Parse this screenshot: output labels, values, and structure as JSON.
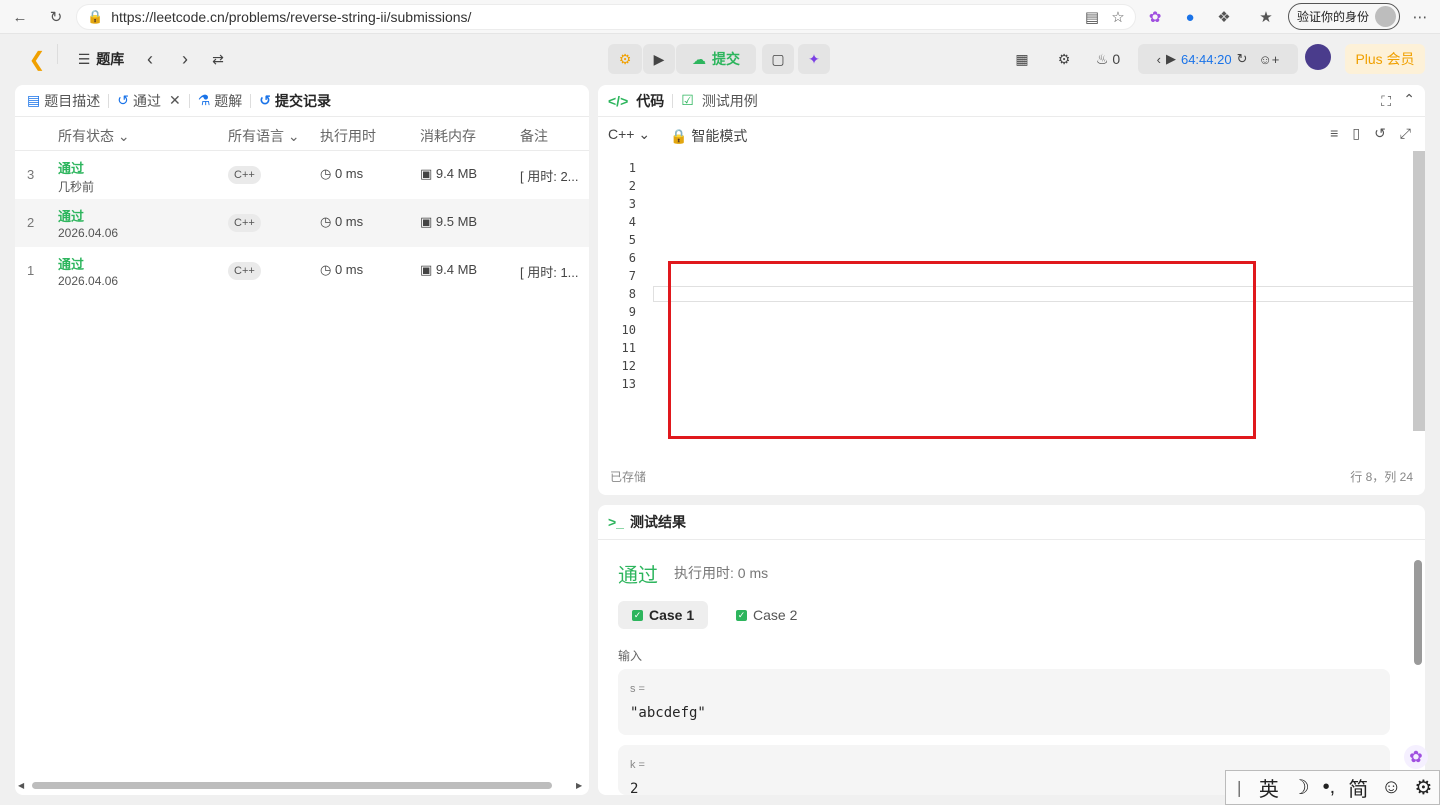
{
  "browser": {
    "url": "https://leetcode.cn/problems/reverse-string-ii/submissions/",
    "verify_label": "验证你的身份"
  },
  "header": {
    "problems_label": "题库",
    "submit_label": "提交",
    "streak_count": "0",
    "timer": "64:44:20",
    "plus_label": "Plus 会员"
  },
  "left": {
    "tabs": [
      "题目描述",
      "通过",
      "题解",
      "提交记录"
    ],
    "columns": [
      "所有状态",
      "所有语言",
      "执行用时",
      "消耗内存",
      "备注"
    ],
    "rows": [
      {
        "n": "3",
        "status": "通过",
        "time": "几秒前",
        "lang": "C++",
        "runtime": "0 ms",
        "memory": "9.4 MB",
        "note": "[ 用时: 2..."
      },
      {
        "n": "2",
        "status": "通过",
        "time": "2026.04.06",
        "lang": "C++",
        "runtime": "0 ms",
        "memory": "9.5 MB",
        "note": ""
      },
      {
        "n": "1",
        "status": "通过",
        "time": "2026.04.06",
        "lang": "C++",
        "runtime": "0 ms",
        "memory": "9.4 MB",
        "note": "[ 用时: 1..."
      }
    ]
  },
  "code": {
    "tab_code": "代码",
    "tab_testcase": "测试用例",
    "language": "C++",
    "mode": "智能模式",
    "line_numbers": [
      "1",
      "2",
      "3",
      "4",
      "5",
      "6",
      "7",
      "8",
      "9",
      "10",
      "11",
      "12",
      "13"
    ],
    "saved": "已存储",
    "cursor": "行 8，列 24"
  },
  "result": {
    "title": "测试结果",
    "status": "通过",
    "runtime": "执行用时: 0 ms",
    "cases": [
      "Case 1",
      "Case 2"
    ],
    "input_label": "输入",
    "var_s": "s =",
    "val_s": "\"abcdefg\"",
    "var_k": "k =",
    "val_k": "2"
  },
  "ime": {
    "lang": "英",
    "simp": "简"
  },
  "colors": {
    "accent_green": "#2db55d",
    "keyword_blue": "#0000ff",
    "comment_green": "#008000",
    "highlight_red": "#e0181d",
    "plus_orange": "#f0a000"
  }
}
